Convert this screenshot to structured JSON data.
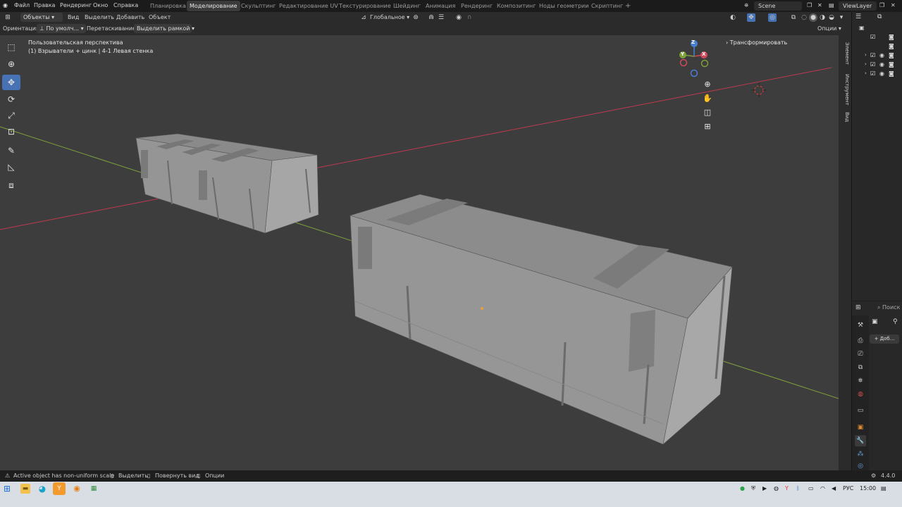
{
  "topbar": {
    "menus": [
      "Файл",
      "Правка",
      "Рендеринг",
      "Окно",
      "Справка"
    ],
    "workspaces": [
      "Планировка",
      "Моделирование",
      "Скульптинг",
      "Редактирование UV",
      "Текстурирование",
      "Шейдинг",
      "Анимация",
      "Рендеринг",
      "Композитинг",
      "Ноды геометрии",
      "Скриптинг"
    ],
    "active_workspace": "Моделирование",
    "add_tab": "+",
    "scene": "Scene",
    "view_layer": "ViewLayer"
  },
  "header": {
    "mode": "Объекты",
    "menus": [
      "Вид",
      "Выделить",
      "Добавить",
      "Объект"
    ],
    "transform_orientation": "Глобальное",
    "options": "Опции"
  },
  "toolsettings": {
    "orientation_label": "Ориентация:",
    "orientation_value": "По умолч...",
    "drag_label": "Перетаскивание:",
    "drag_value": "Выделить рамкой"
  },
  "viewport": {
    "perspective": "Пользовательская перспектива",
    "object_info": "(1) Взрыватели + цинк | 4-1 Левая стенка",
    "transform_panel": "Трансформировать",
    "gizmo_axes": [
      "X",
      "Y",
      "Z"
    ],
    "nav_icons": [
      "zoom-icon",
      "hand-icon",
      "camera-icon",
      "grid-icon"
    ]
  },
  "sidetabs": [
    "Элемент",
    "Инструмент",
    "Вид"
  ],
  "properties": {
    "search_placeholder": "Поиск",
    "add_button": "+ Доб..."
  },
  "statusbar": {
    "warning": "Active object has non-uniform scale",
    "select": "Выделить",
    "rotate": "Повернуть вид",
    "options": "Опции",
    "version": "4.4.0"
  },
  "taskbar": {
    "lang": "РУС",
    "time": "15:00"
  },
  "colors": {
    "accent": "#4772b3",
    "viewport_bg": "#3d3d3d",
    "x_axis": "#c0394f",
    "y_axis": "#7ea03a"
  }
}
